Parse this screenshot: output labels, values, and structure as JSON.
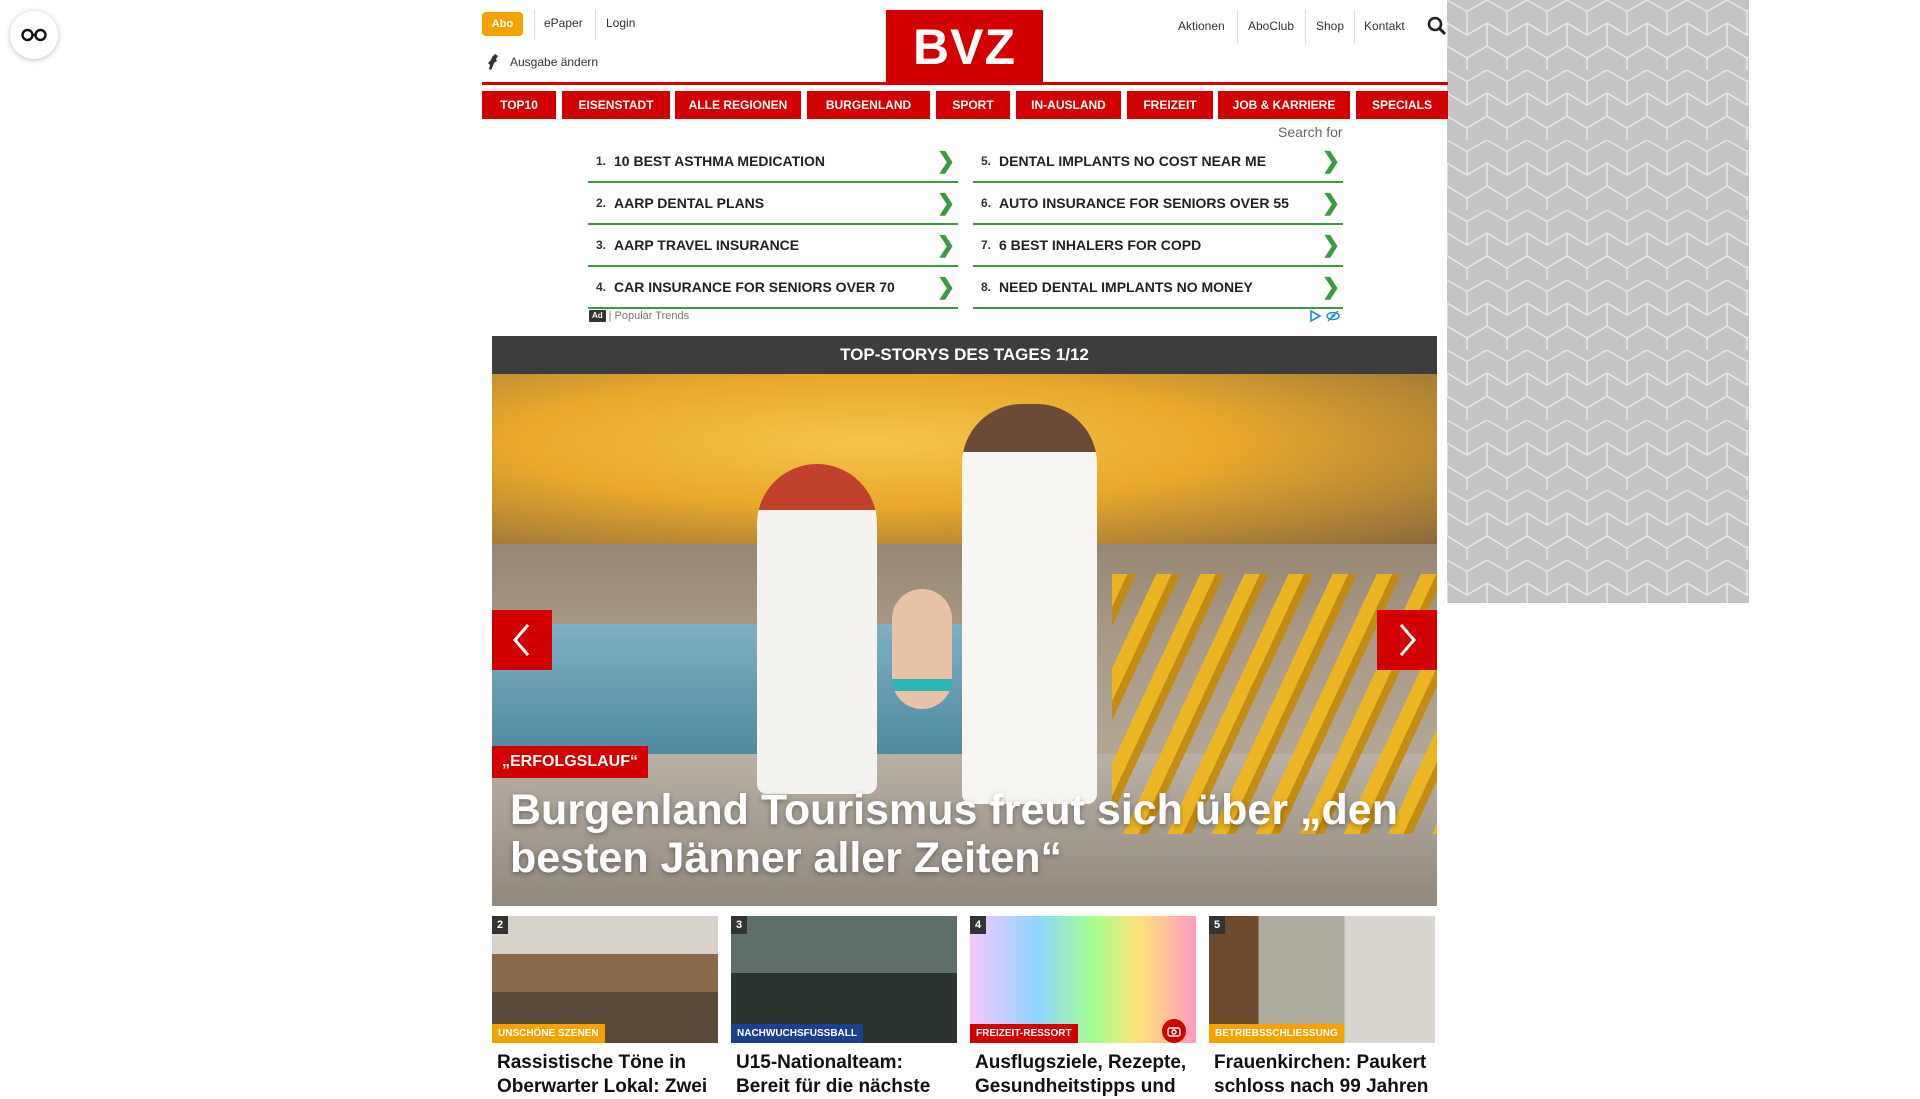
{
  "header": {
    "abo_label": "Abo",
    "epaper_label": "ePaper",
    "login_label": "Login",
    "ausgabe_label": "Ausgabe ändern",
    "logo_text": "BVZ",
    "right_links": [
      "Aktionen",
      "AboClub",
      "Shop",
      "Kontakt"
    ]
  },
  "nav": [
    "TOP10",
    "EISENSTADT",
    "ALLE REGIONEN",
    "BURGENLAND",
    "SPORT",
    "IN-AUSLAND",
    "FREIZEIT",
    "JOB & KARRIERE",
    "SPECIALS"
  ],
  "ads": {
    "search_for": "Search for",
    "left": [
      {
        "num": "1.",
        "text": "10 BEST ASTHMA MEDICATION"
      },
      {
        "num": "2.",
        "text": "AARP DENTAL PLANS"
      },
      {
        "num": "3.",
        "text": "AARP TRAVEL INSURANCE"
      },
      {
        "num": "4.",
        "text": "CAR INSURANCE FOR SENIORS OVER 70"
      }
    ],
    "right": [
      {
        "num": "5.",
        "text": "DENTAL IMPLANTS NO COST NEAR ME"
      },
      {
        "num": "6.",
        "text": "AUTO INSURANCE FOR SENIORS OVER 55"
      },
      {
        "num": "7.",
        "text": "6 BEST INHALERS FOR COPD"
      },
      {
        "num": "8.",
        "text": "NEED DENTAL IMPLANTS NO MONEY"
      }
    ],
    "ad_badge": "Ad",
    "footer_label": "Popular Trends"
  },
  "top_stories": {
    "bar_title": "TOP-STORYS DES TAGES 1/12",
    "hero_kicker": "„ERFOLGSLAUF“",
    "hero_title": "Burgenland Tourismus freut sich über „den besten Jänner aller Zeiten“"
  },
  "cards": [
    {
      "num": "2",
      "category": "UNSCHÖNE SZENEN",
      "title": "Rassistische Töne in Oberwarter Lokal: Zwei"
    },
    {
      "num": "3",
      "category": "NACHWUCHSFUSSBALL",
      "title": "U15-Nationalteam: Bereit für die nächste"
    },
    {
      "num": "4",
      "category": "FREIZEIT-RESSORT",
      "title": "Ausflugsziele, Rezepte, Gesundheitstipps und"
    },
    {
      "num": "5",
      "category": "BETRIEBSSCHLIESSUNG",
      "title": "Frauenkirchen: Paukert schloss nach 99 Jahren"
    }
  ],
  "colors": {
    "brand_red": "#d20000",
    "abo_orange": "#f5a200",
    "ad_green": "#3e9a42",
    "cat_orange": "#f5a200",
    "cat_blue": "#1d3f8f"
  }
}
